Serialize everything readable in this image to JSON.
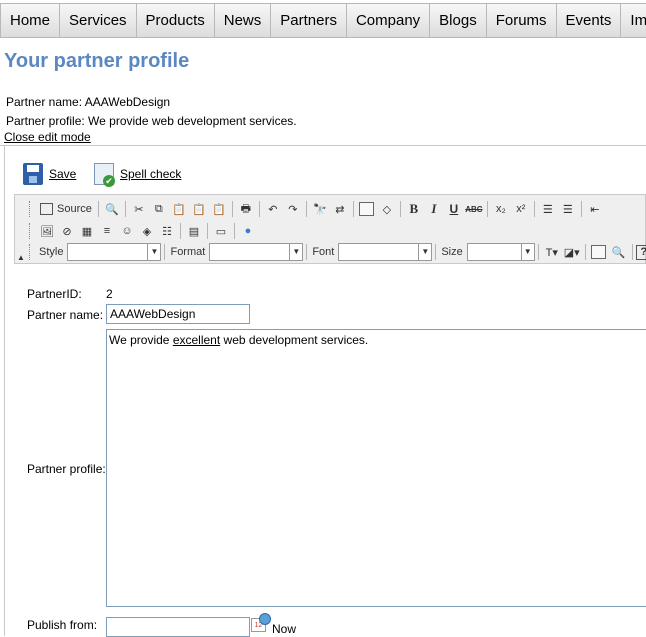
{
  "nav": [
    "Home",
    "Services",
    "Products",
    "News",
    "Partners",
    "Company",
    "Blogs",
    "Forums",
    "Events",
    "Images"
  ],
  "page_title": "Your partner profile",
  "info": {
    "partner_name_label": "Partner name:",
    "partner_name_value": "AAAWebDesign",
    "partner_profile_label": "Partner profile:",
    "partner_profile_value": "We provide web development services."
  },
  "close_edit_mode": "Close edit mode",
  "actions": {
    "save": "Save",
    "spell_check": "Spell check"
  },
  "toolbar": {
    "source": "Source",
    "style_label": "Style",
    "format_label": "Format",
    "font_label": "Font",
    "size_label": "Size"
  },
  "form": {
    "partner_id_label": "PartnerID:",
    "partner_id_value": "2",
    "partner_name_label": "Partner name:",
    "partner_name_value": "AAAWebDesign",
    "partner_profile_label": "Partner profile:",
    "profile_before": "We provide ",
    "profile_underlined": "excellent",
    "profile_after": " web development services.",
    "publish_from_label": "Publish from:",
    "now_label": "Now"
  }
}
